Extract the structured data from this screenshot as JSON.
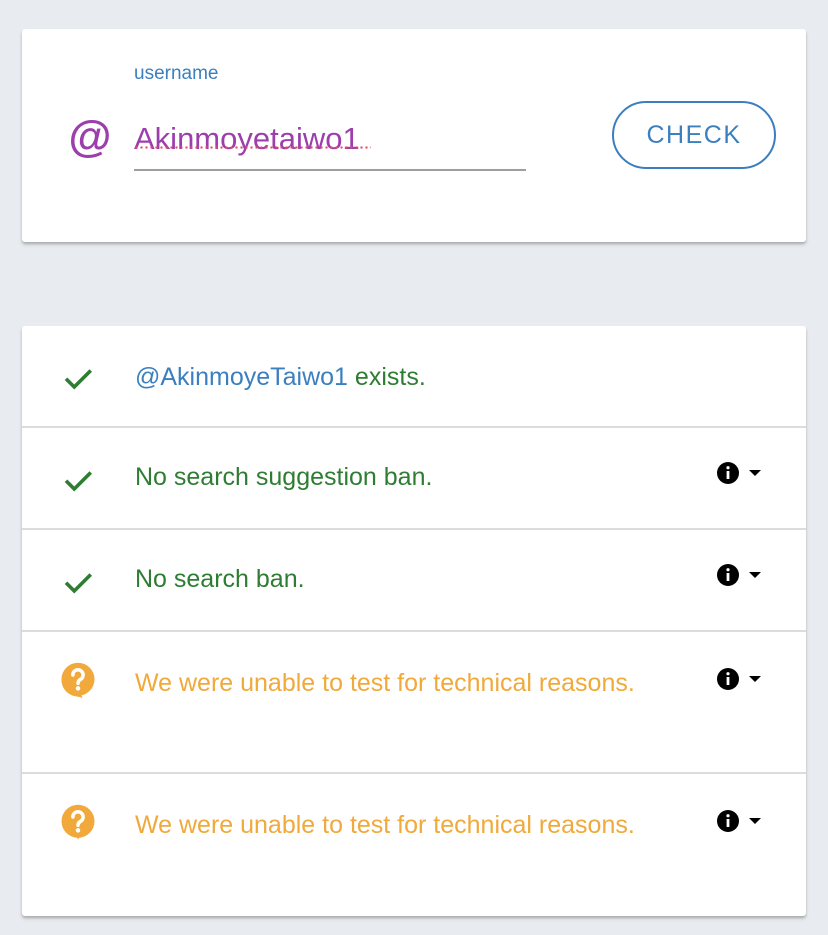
{
  "search": {
    "label": "username",
    "value": "Akinmoyetaiwo1",
    "button_label": "CHECK",
    "at_symbol": "@"
  },
  "results": [
    {
      "status": "ok",
      "icon": "check-icon",
      "handle": "@AkinmoyeTaiwo1",
      "text": "exists.",
      "has_info": false
    },
    {
      "status": "ok",
      "icon": "check-icon",
      "text": "No search suggestion ban.",
      "has_info": true
    },
    {
      "status": "ok",
      "icon": "check-icon",
      "text": "No search ban.",
      "has_info": true
    },
    {
      "status": "warn",
      "icon": "question-bubble-icon",
      "text": "We were unable to test for technical reasons.",
      "has_info": true
    },
    {
      "status": "warn",
      "icon": "question-bubble-icon",
      "text": "We were unable to test for technical reasons.",
      "has_info": true
    }
  ],
  "colors": {
    "background": "#e8ebef",
    "accent": "#3b7fbf",
    "username_text": "#9c3fad",
    "success": "#2e7d32",
    "warning": "#f0a93a"
  }
}
